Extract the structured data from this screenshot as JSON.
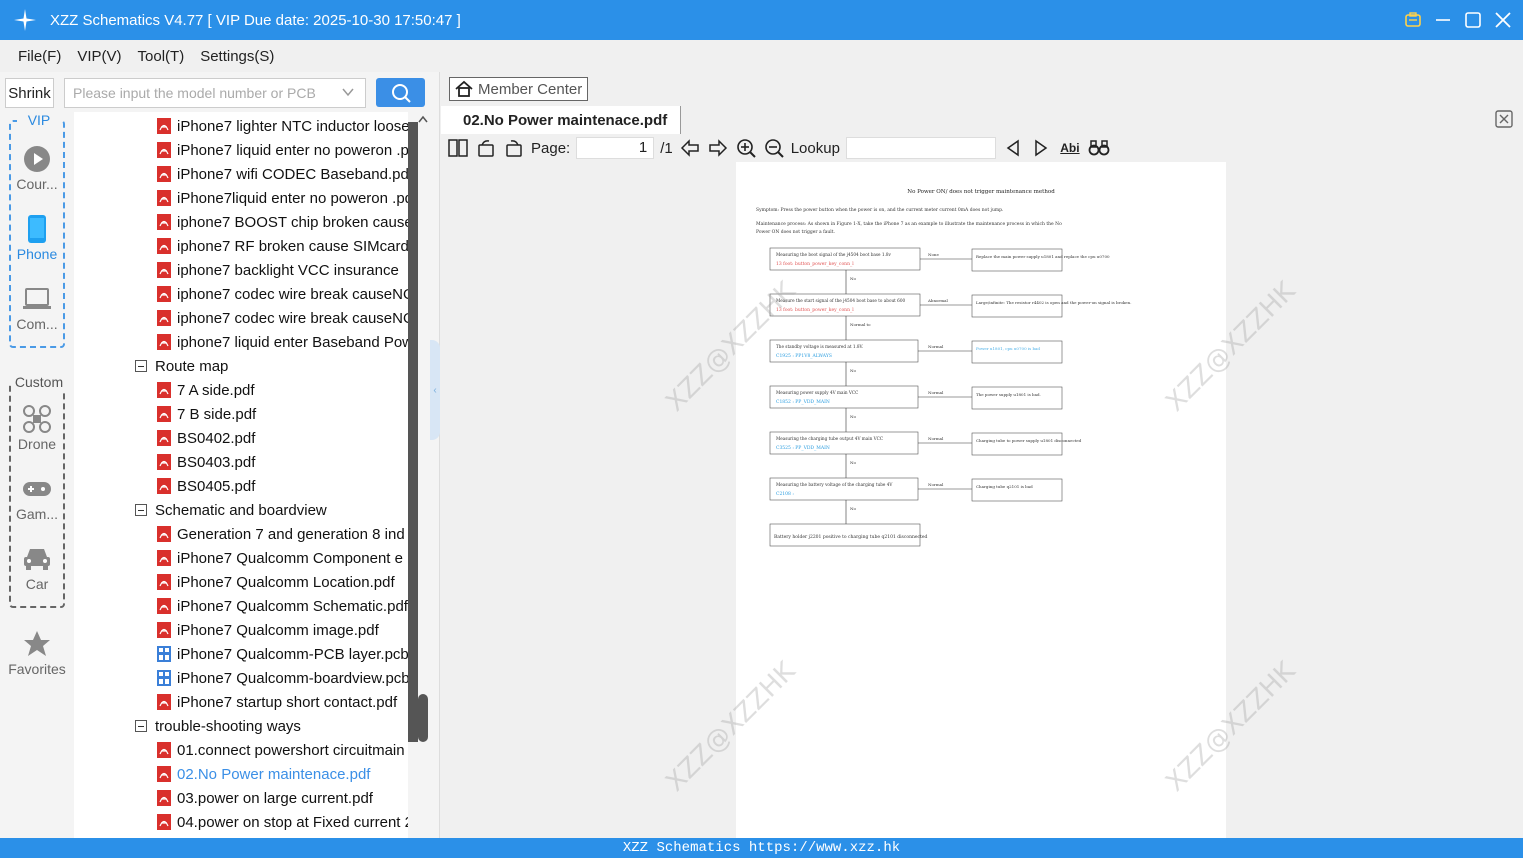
{
  "window": {
    "title": "XZZ Schematics V4.77 [ VIP Due date: 2025-10-30 17:50:47 ]"
  },
  "menu": [
    "File(F)",
    "VIP(V)",
    "Tool(T)",
    "Settings(S)"
  ],
  "left": {
    "shrink_label": "Shrink",
    "search_placeholder": "Please input the model number or PCB",
    "vip_label": "VIP",
    "custom_label": "Custom",
    "categories": [
      {
        "label": "Cour...",
        "icon": "play-icon"
      },
      {
        "label": "Phone",
        "icon": "phone-icon"
      },
      {
        "label": "Com...",
        "icon": "laptop-icon"
      },
      {
        "label": "Drone",
        "icon": "drone-icon"
      },
      {
        "label": "Gam...",
        "icon": "gamepad-icon"
      },
      {
        "label": "Car",
        "icon": "car-icon"
      },
      {
        "label": "Favorites",
        "icon": "star-icon"
      }
    ],
    "tree": [
      {
        "type": "pdf",
        "label": "iPhone7 lighter NTC inductor loose"
      },
      {
        "type": "pdf",
        "label": "iPhone7 liquid enter no poweron .pdf"
      },
      {
        "type": "pdf",
        "label": "iPhone7 wifi CODEC  Baseband.pdf"
      },
      {
        "type": "pdf",
        "label": "iPhone7liquid enter no poweron .pdf"
      },
      {
        "type": "pdf",
        "label": "iphone7  BOOST chip  broken cause"
      },
      {
        "type": "pdf",
        "label": "iphone7 RF broken cause SIMcard"
      },
      {
        "type": "pdf",
        "label": "iphone7 backlight  VCC insurance"
      },
      {
        "type": "pdf",
        "label": "iphone7 codec wire break causeNO"
      },
      {
        "type": "pdf",
        "label": "iphone7 codec wire break causeNO"
      },
      {
        "type": "pdf",
        "label": "iphone7 liquid enter Baseband Pow"
      },
      {
        "type": "folder",
        "label": "Route map"
      },
      {
        "type": "pdf",
        "label": "7 A side.pdf"
      },
      {
        "type": "pdf",
        "label": "7 B side.pdf"
      },
      {
        "type": "pdf",
        "label": "BS0402.pdf"
      },
      {
        "type": "pdf",
        "label": "BS0403.pdf"
      },
      {
        "type": "pdf",
        "label": "BS0405.pdf"
      },
      {
        "type": "folder",
        "label": "Schematic and boardview"
      },
      {
        "type": "pdf",
        "label": "Generation 7 and generation 8 ind"
      },
      {
        "type": "pdf",
        "label": "iPhone7 Qualcomm Component e"
      },
      {
        "type": "pdf",
        "label": "iPhone7 Qualcomm Location.pdf"
      },
      {
        "type": "pdf",
        "label": "iPhone7 Qualcomm Schematic.pdf"
      },
      {
        "type": "pdf",
        "label": "iPhone7 Qualcomm image.pdf"
      },
      {
        "type": "pcb",
        "label": "iPhone7 Qualcomm-PCB layer.pcb"
      },
      {
        "type": "pcb",
        "label": "iPhone7 Qualcomm-boardview.pcb"
      },
      {
        "type": "pdf",
        "label": "iPhone7 startup short contact.pdf"
      },
      {
        "type": "folder",
        "label": "trouble-shooting ways"
      },
      {
        "type": "pdf",
        "label": "01.connect powershort circuitmain"
      },
      {
        "type": "pdf",
        "label": "02.No Power maintenace.pdf",
        "selected": true
      },
      {
        "type": "pdf",
        "label": "03.power on large current.pdf"
      },
      {
        "type": "pdf",
        "label": "04.power on stop at Fixed current 2"
      }
    ]
  },
  "right": {
    "member_center": "Member Center",
    "tab_title": "02.No Power maintenace.pdf",
    "page_label": "Page:",
    "page_value": "1",
    "page_total": "/1",
    "lookup_label": "Lookup",
    "watermark": "XZZ@XZZHK"
  },
  "document": {
    "title": "No Power ON/ does not trigger maintenance method",
    "symptom": "Symptom: Press the power button when the power is on, and the current meter current 0mA does not jump.",
    "process1": "Maintenance process: As shown in Figure 1-X, take the iPhone 7 as an example to illustrate the maintenance process in which the No",
    "process2": "Power ON does not trigger a fault.",
    "steps": [
      {
        "text": "Measuring the boot signal of the j4504 boot base 1.8v",
        "sub": "13 foot: button_power_key_conn_l",
        "side": "Replace the main power supply u1801 and replace the cpu u0700",
        "edge": "None"
      },
      {
        "text": "Measure the start signal of the j4504 boot base to about 600",
        "sub": "13 foot: button_power_key_conn_l",
        "side": "Large/infinite: The resistor r4402 is open and the power-on signal is broken.",
        "edge": "Abnormal"
      },
      {
        "text": "The standby voltage is measured at 1.8V.",
        "sub": "C1925 :  PP1V8_ALWAYS",
        "side": "Power u1801, cpu u0700 is bad",
        "edge": "Normal"
      },
      {
        "text": "Measuring power supply 4V main VCC",
        "sub": "C1852 :  PP_VDD_MAIN",
        "side": "The power supply u1801 is bad.",
        "edge": "Normal"
      },
      {
        "text": "Measuring the charging tube output 4V main VCC",
        "sub": "C3525 :  PP_VDD_MAIN",
        "side": "Charging tube to power supply u1801 disconnected",
        "edge": "Normal"
      },
      {
        "text": "Measuring the battery voltage of the charging tube 4V",
        "sub": "C2108 :",
        "side": "Charging tube q2101 is bad",
        "edge": "Normal"
      }
    ],
    "final": "Battery holder j2201 positive to charging tube q2101 disconnected",
    "down_labels": [
      "No",
      "Normal to",
      "No",
      "No",
      "No",
      "No"
    ]
  },
  "status": "XZZ Schematics https://www.xzz.hk",
  "colors": {
    "accent": "#2b90e8",
    "pdf": "#d9302c",
    "selected": "#3b8fe6"
  }
}
